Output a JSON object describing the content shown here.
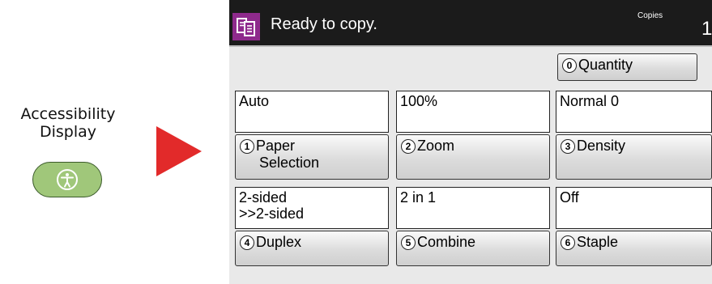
{
  "accessibility": {
    "label_line1": "Accessibility",
    "label_line2": "Display",
    "button_icon": "accessibility-person-icon",
    "button_color": "#a0c77a"
  },
  "arrow": {
    "color": "#e22a2a"
  },
  "panel": {
    "mode_icon": "copy-icon",
    "mode_color": "#8e2a8c",
    "status": "Ready to copy.",
    "copies_label": "Copies",
    "copies_value": "1",
    "quantity": {
      "num": "0",
      "label": "Quantity"
    },
    "settings": [
      {
        "value": [
          "Auto"
        ],
        "num": "1",
        "label_line1": "Paper",
        "label_line2": "Selection"
      },
      {
        "value": [
          "100%"
        ],
        "num": "2",
        "label_line1": "Zoom",
        "label_line2": ""
      },
      {
        "value": [
          "Normal 0"
        ],
        "num": "3",
        "label_line1": "Density",
        "label_line2": ""
      },
      {
        "value": [
          "2-sided",
          ">>2-sided"
        ],
        "num": "4",
        "label_line1": "Duplex",
        "label_line2": ""
      },
      {
        "value": [
          "2 in 1"
        ],
        "num": "5",
        "label_line1": "Combine",
        "label_line2": ""
      },
      {
        "value": [
          "Off"
        ],
        "num": "6",
        "label_line1": "Staple",
        "label_line2": ""
      }
    ]
  }
}
